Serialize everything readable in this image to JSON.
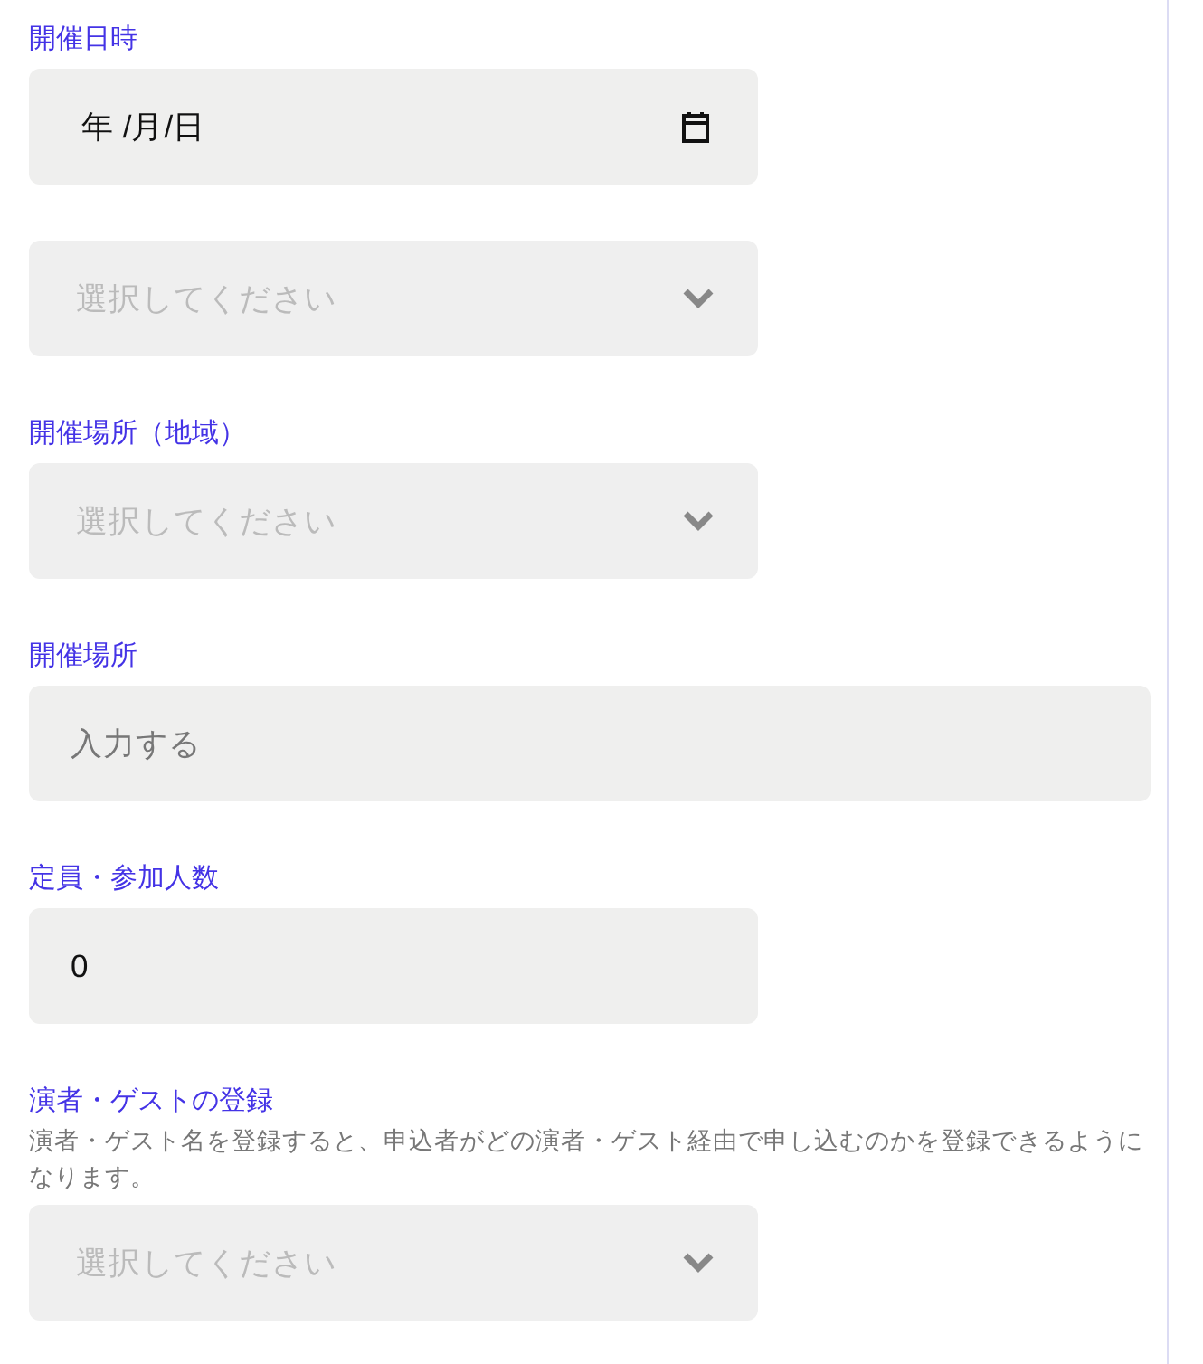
{
  "fields": [
    {
      "label": "開催日時",
      "kind": "date",
      "value": "年 /月/日"
    },
    {
      "kind": "select",
      "placeholder": "選択してください"
    },
    {
      "label": "開催場所（地域）",
      "kind": "select",
      "placeholder": "選択してください"
    },
    {
      "label": "開催場所",
      "kind": "text",
      "placeholder": "入力する"
    },
    {
      "label": "定員・参加人数",
      "kind": "number",
      "value": "0"
    },
    {
      "label": "演者・ゲストの登録",
      "description": "演者・ゲスト名を登録すると、申込者がどの演者・ゲスト経由で申し込むのかを登録できるようになります。",
      "kind": "select",
      "placeholder": "選択してください"
    }
  ]
}
